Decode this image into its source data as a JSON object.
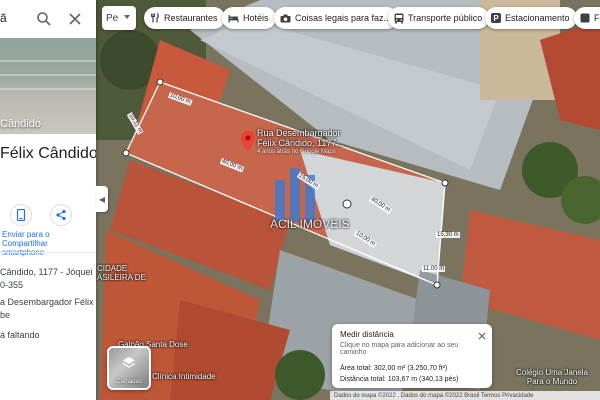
{
  "side_panel": {
    "search_query": "ã",
    "photo_label": "Cândido",
    "place_title": "Félix Cândido,",
    "actions": {
      "send_to_phone_label": "Enviar para o Compartilhar smartphone"
    },
    "address_line_1": "Cândido, 1177 - Jóquei 0-355",
    "address_line_2": "a Desembargador Félix be",
    "missing_line": "á faltando"
  },
  "map": {
    "layers_mini_label": "Pe",
    "chips": [
      {
        "label": "Restaurantes",
        "icon": "fork-knife-icon"
      },
      {
        "label": "Hotéis",
        "icon": "bed-icon"
      },
      {
        "label": "Coisas legais para faz...",
        "icon": "camera-icon"
      },
      {
        "label": "Transporte público",
        "icon": "bus-icon"
      },
      {
        "label": "Estacionamento",
        "icon": "parking-icon"
      },
      {
        "label": "Fa",
        "icon": "more-icon"
      }
    ],
    "pin": {
      "label_line_1": "Rua Desembargador",
      "label_line_2": "Félix Cândido, 1177...",
      "sublabel": "4 anos atrás no Google Maps"
    },
    "street_labels": {
      "cidade": "CIDADE",
      "brasileira": "ASILEIRA DE",
      "galpao": "Galpão Santa Dose",
      "clinica": "Clínica Intimidade",
      "loja": "Colégio Uma Janela Para o Mundo",
      "acil": "ACIL IMÓVEIS"
    },
    "distance_labels": [
      "10,00 m",
      "10,11 m",
      "40,00 m",
      "40,00 m",
      "15,00 m",
      "10,00 m",
      "15,30 m",
      "11,00 m"
    ],
    "layers_label": "Camadas",
    "footer": "Dados do mapa ©2022 , Dados do mapa ©2022   Brasil   Termos   Privacidade"
  },
  "measure": {
    "title": "Medir distância",
    "hint": "Clique no mapa para adicionar ao seu caminho",
    "area": "Área total: 302,00 m² (3.250,70 ft²)",
    "distance": "Distância total: 103,67 m (340,13 pés)"
  },
  "colors": {
    "link_blue": "#1a73e8",
    "pin_red": "#ea4335",
    "roof_red": "#c8553a",
    "measure_line": "#ffffff"
  }
}
